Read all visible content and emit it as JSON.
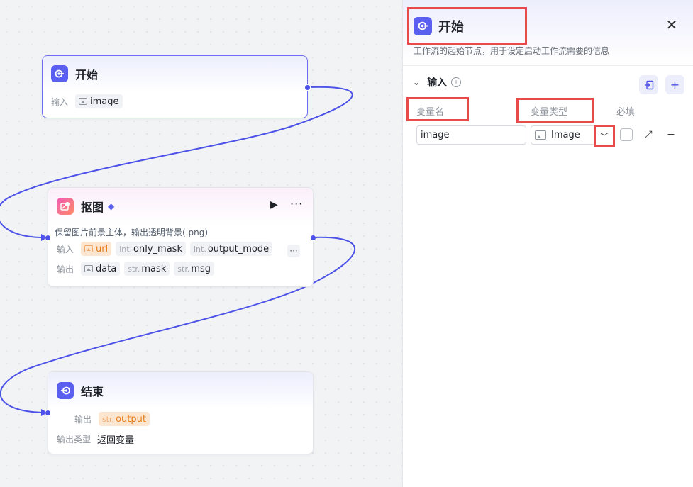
{
  "canvas": {
    "start_node": {
      "title": "开始",
      "inputs_label": "输入",
      "inputs": [
        {
          "name": "image",
          "icon": "image-icon"
        }
      ]
    },
    "cutout_node": {
      "title": "抠图",
      "description": "保留图片前景主体，输出透明背景(.png)",
      "inputs_label": "输入",
      "inputs": [
        {
          "prefix": "",
          "name": "url",
          "icon": "image-icon",
          "highlight": true
        },
        {
          "prefix": "int.",
          "name": "only_mask"
        },
        {
          "prefix": "int.",
          "name": "output_mode"
        }
      ],
      "outputs_label": "输出",
      "outputs": [
        {
          "prefix": "",
          "name": "data",
          "icon": "image-icon"
        },
        {
          "prefix": "str.",
          "name": "mask"
        },
        {
          "prefix": "str.",
          "name": "msg"
        }
      ],
      "more_label": "···"
    },
    "end_node": {
      "title": "结束",
      "output_label": "输出",
      "output": {
        "prefix": "str.",
        "name": "output"
      },
      "output_type_label": "输出类型",
      "output_type_value": "返回变量"
    }
  },
  "panel": {
    "title": "开始",
    "description": "工作流的起始节点，用于设定启动工作流需要的信息",
    "section_title": "输入",
    "columns": {
      "name": "变量名",
      "type": "变量类型",
      "required": "必填"
    },
    "variable": {
      "name": "image",
      "type": "Image",
      "required": false
    }
  },
  "colors": {
    "accent": "#4c52e8",
    "highlight_box": "#e84a4a",
    "tag_orange": "#e67e1e"
  }
}
